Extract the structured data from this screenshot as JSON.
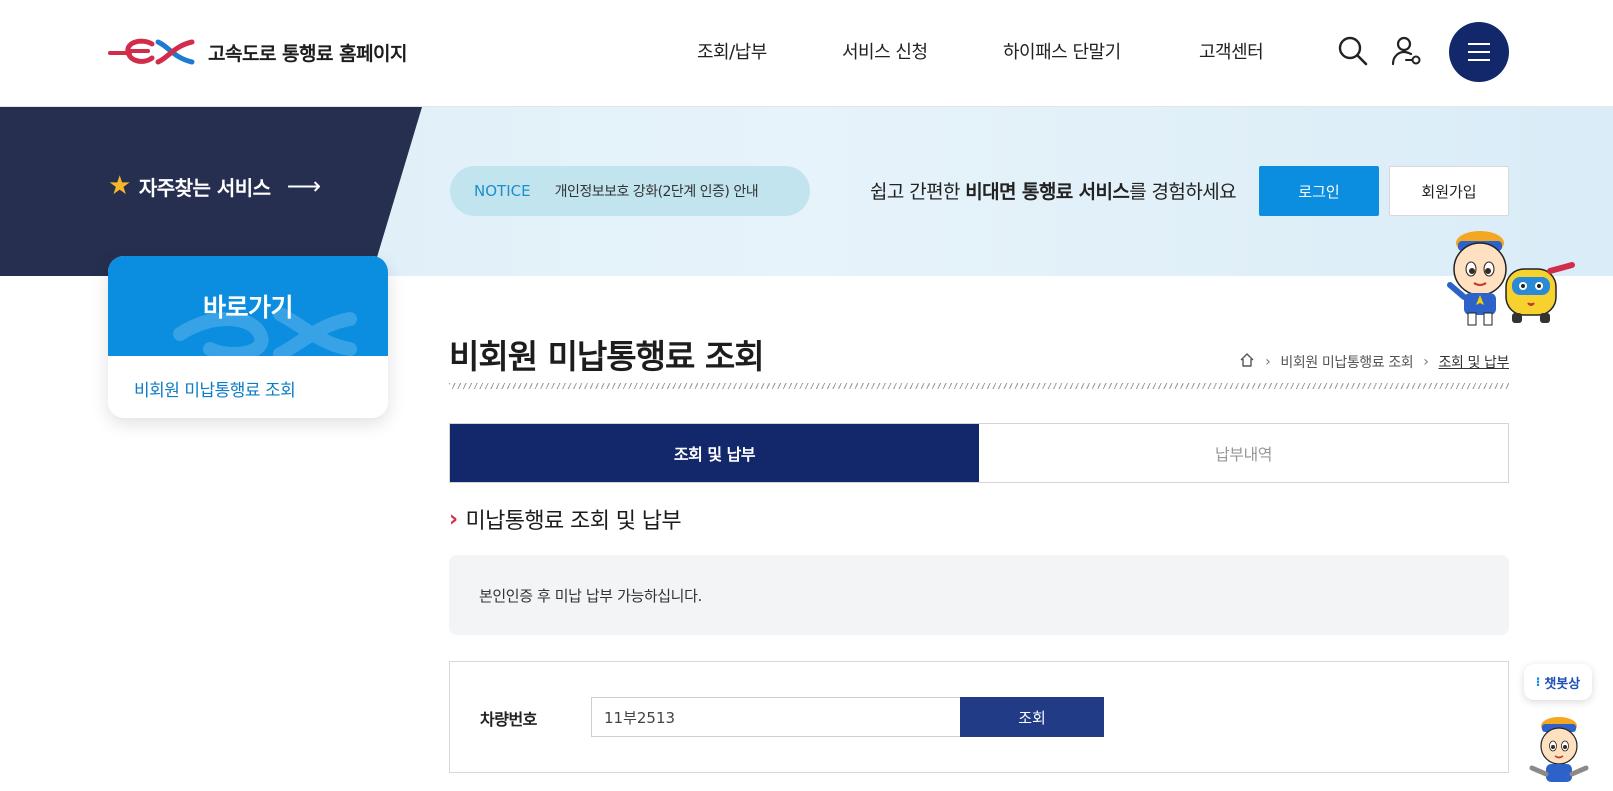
{
  "header": {
    "logo_text": "고속도로 통행료 홈페이지",
    "nav": [
      "조회/납부",
      "서비스 신청",
      "하이패스 단말기",
      "고객센터"
    ],
    "icons": [
      "search-icon",
      "user-icon",
      "menu-icon"
    ]
  },
  "banner": {
    "favorites_label": "자주찾는 서비스",
    "notice_label": "NOTICE",
    "notice_text": "개인정보보호 강화(2단계 인증) 안내",
    "promo_pre": "쉽고 간편한 ",
    "promo_bold": "비대면 통행료 서비스",
    "promo_post": "를 경험하세요",
    "login_label": "로그인",
    "join_label": "회원가입"
  },
  "side": {
    "title": "바로가기",
    "link": "비회원 미납통행료 조회"
  },
  "main": {
    "page_title": "비회원 미납통행료 조회",
    "breadcrumb": [
      "비회원 미납통행료 조회",
      "조회 및 납부"
    ],
    "tabs": [
      {
        "label": "조회 및 납부",
        "active": true
      },
      {
        "label": "납부내역",
        "active": false
      }
    ],
    "section_title": "미납통행료 조회 및 납부",
    "info_text": "본인인증 후 미납 납부 가능하십니다.",
    "form": {
      "label": "차량번호",
      "value": "11부2513",
      "button": "조회"
    }
  },
  "chatbot": {
    "label": "챗봇상"
  },
  "colors": {
    "navy": "#13286b",
    "blue": "#0b8ee0",
    "banner_dark": "#262f4f",
    "accent_red": "#d12d4a"
  }
}
